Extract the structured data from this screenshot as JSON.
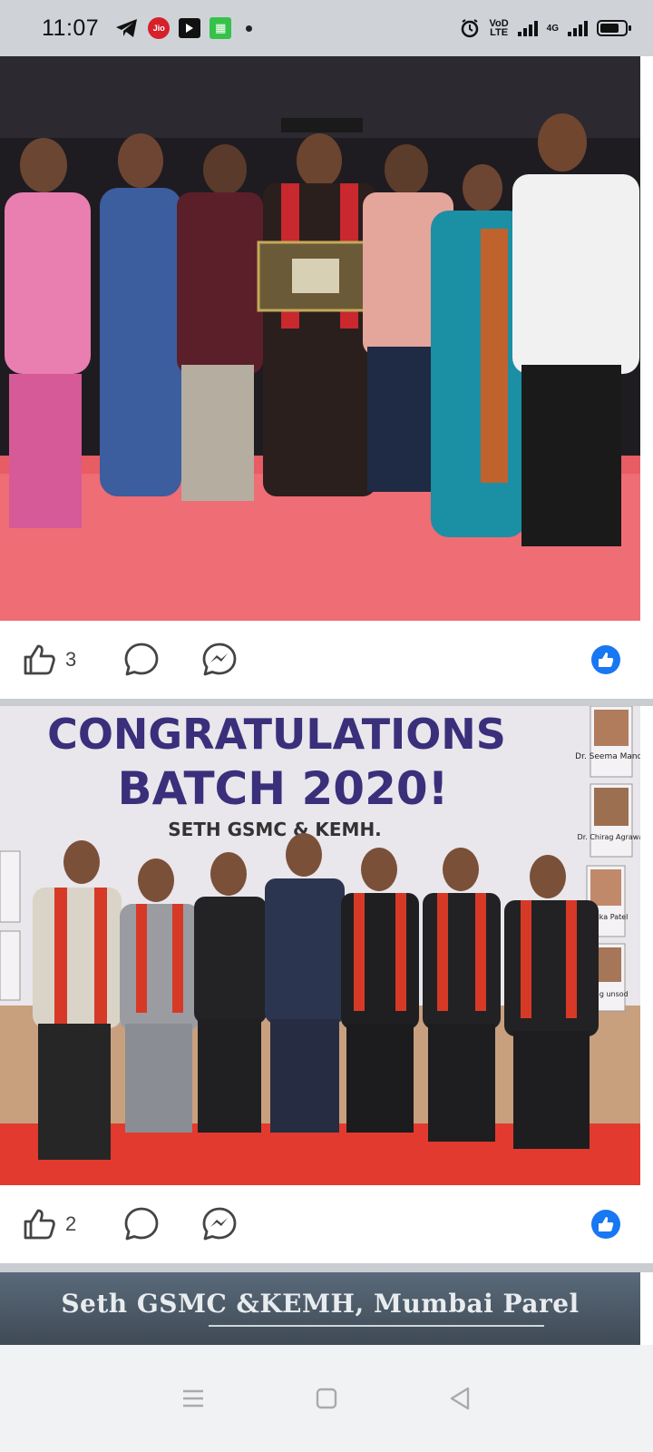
{
  "status_bar": {
    "time": "11:07",
    "jio_label": "Jio",
    "lte_top": "VoD",
    "lte_bottom": "LTE",
    "network": "4G",
    "battery_level": 0.75
  },
  "posts": [
    {
      "photo_alt": "Graduation family group photo",
      "like_count": "3"
    },
    {
      "banner": {
        "line1": "CONGRATULATIONS",
        "line2": "BATCH 2020!",
        "line3": "SETH GSMC & KEMH."
      },
      "side_names": [
        "Dr. Seema Mande",
        "Dr. Chirag Agrawal",
        "Kunika Patel",
        "Parag unsod"
      ],
      "like_count": "2"
    },
    {
      "banner_text": "Seth GSMC &KEMH, Mumbai Parel"
    }
  ],
  "icons": {
    "like": "thumbs-up-icon",
    "comment": "comment-icon",
    "share": "messenger-icon",
    "reaction": "like-reaction-icon",
    "nav_menu": "menu-icon",
    "nav_home": "home-square-icon",
    "nav_back": "back-triangle-icon"
  },
  "colors": {
    "facebook_blue": "#1877f2",
    "banner_purple": "#3a2f7a",
    "carpet_red": "#d9302b"
  }
}
